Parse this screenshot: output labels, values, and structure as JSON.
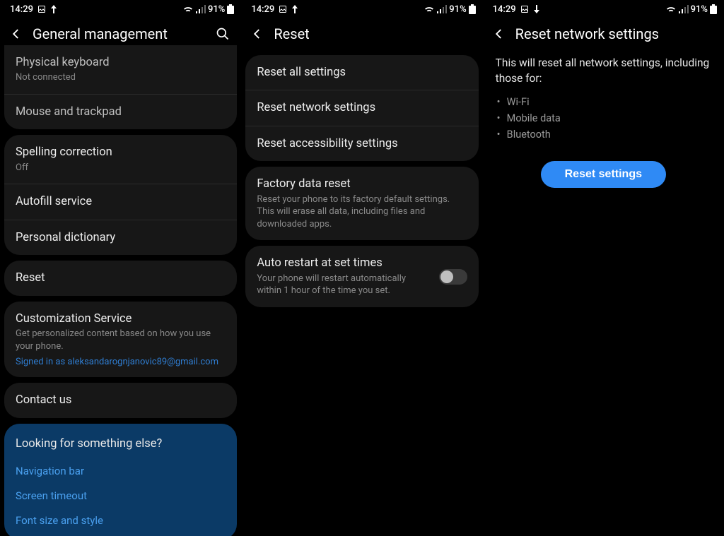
{
  "status": {
    "time": "14:29",
    "battery": "91%"
  },
  "phone1": {
    "title": "General management",
    "physical_keyboard": {
      "title": "Physical keyboard",
      "sub": "Not connected"
    },
    "mouse_trackpad": "Mouse and trackpad",
    "spelling": {
      "title": "Spelling correction",
      "sub": "Off"
    },
    "autofill": "Autofill service",
    "personal_dictionary": "Personal dictionary",
    "reset": "Reset",
    "customization": {
      "title": "Customization Service",
      "sub": "Get personalized content based on how you use your phone.",
      "link": "Signed in as aleksandarognjanovic89@gmail.com"
    },
    "contact_us": "Contact us",
    "looking": {
      "title": "Looking for something else?",
      "nav_bar": "Navigation bar",
      "screen_timeout": "Screen timeout",
      "font_style": "Font size and style"
    }
  },
  "phone2": {
    "title": "Reset",
    "reset_all": "Reset all settings",
    "reset_network": "Reset network settings",
    "reset_accessibility": "Reset accessibility settings",
    "factory": {
      "title": "Factory data reset",
      "sub": "Reset your phone to its factory default settings. This will erase all data, including files and downloaded apps."
    },
    "auto_restart": {
      "title": "Auto restart at set times",
      "sub": "Your phone will restart automatically within 1 hour of the time you set."
    }
  },
  "phone3": {
    "title": "Reset network settings",
    "body": "This will reset all network settings, including those for:",
    "bullets": {
      "wifi": "Wi-Fi",
      "mobile": "Mobile data",
      "bluetooth": "Bluetooth"
    },
    "button": "Reset settings"
  }
}
